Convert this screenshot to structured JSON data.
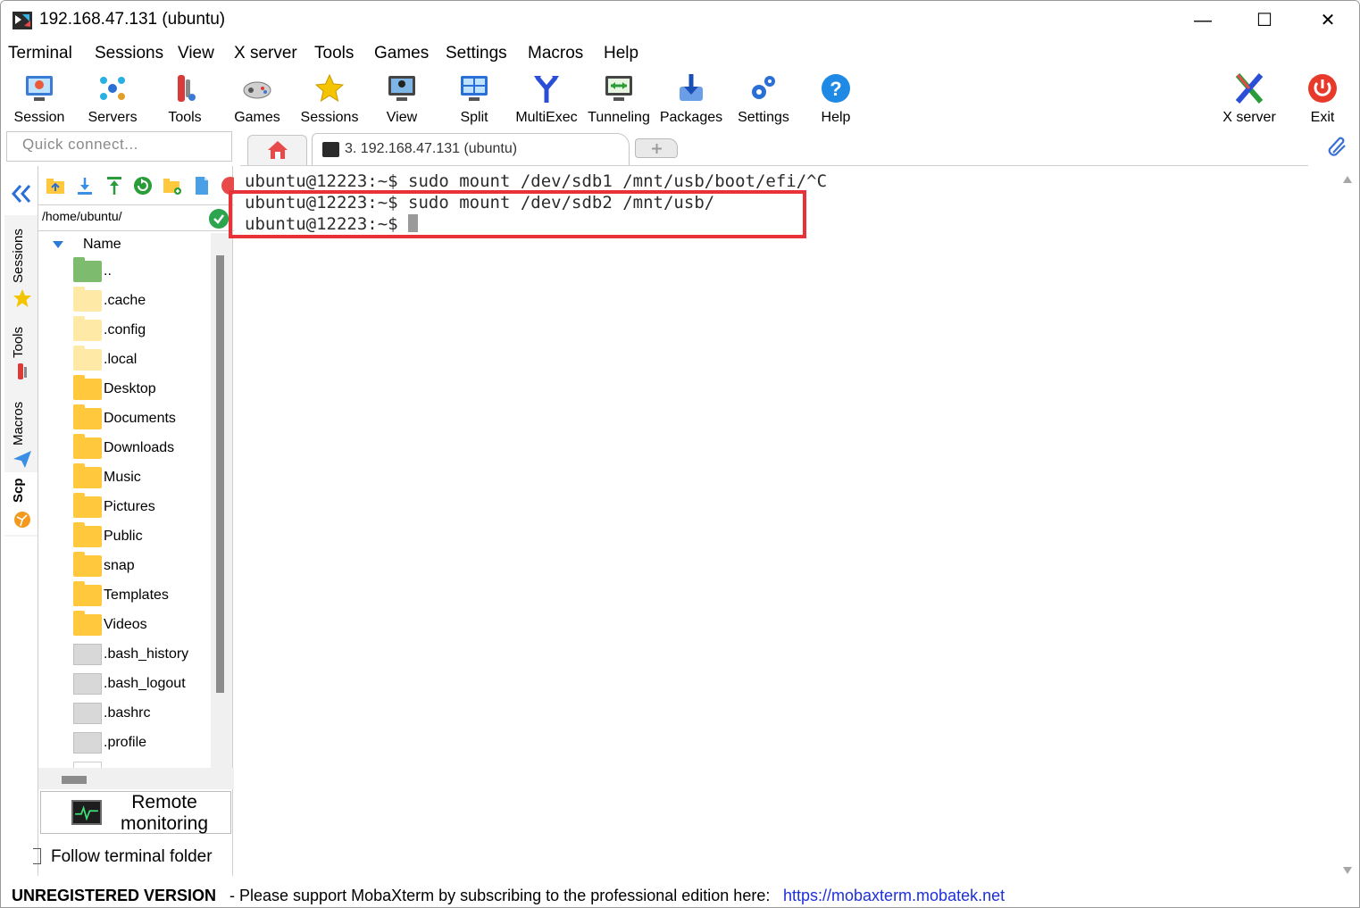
{
  "window": {
    "title": "192.168.47.131 (ubuntu)",
    "minimize_glyph": "—",
    "maximize_glyph": "☐",
    "close_glyph": "✕"
  },
  "menu": [
    "Terminal",
    "Sessions",
    "View",
    "X server",
    "Tools",
    "Games",
    "Settings",
    "Macros",
    "Help"
  ],
  "toolbar": {
    "session": "Session",
    "servers": "Servers",
    "tools": "Tools",
    "games": "Games",
    "sessions": "Sessions",
    "view": "View",
    "split": "Split",
    "multiexec": "MultiExec",
    "tunneling": "Tunneling",
    "packages": "Packages",
    "settings": "Settings",
    "help": "Help",
    "xserver": "X server",
    "exit": "Exit"
  },
  "quick_connect": {
    "placeholder": "Quick connect..."
  },
  "tabs": {
    "active_label": "3. 192.168.47.131 (ubuntu)"
  },
  "side_tabs": [
    "Sessions",
    "Tools",
    "Macros",
    "Scp"
  ],
  "file_browser": {
    "path": "/home/ubuntu/",
    "column_name": "Name",
    "entries": [
      {
        "name": "..",
        "kind": "up"
      },
      {
        "name": ".cache",
        "kind": "hidden-folder"
      },
      {
        "name": ".config",
        "kind": "hidden-folder"
      },
      {
        "name": ".local",
        "kind": "hidden-folder"
      },
      {
        "name": "Desktop",
        "kind": "folder"
      },
      {
        "name": "Documents",
        "kind": "folder"
      },
      {
        "name": "Downloads",
        "kind": "folder"
      },
      {
        "name": "Music",
        "kind": "folder"
      },
      {
        "name": "Pictures",
        "kind": "folder"
      },
      {
        "name": "Public",
        "kind": "folder"
      },
      {
        "name": "snap",
        "kind": "folder"
      },
      {
        "name": "Templates",
        "kind": "folder"
      },
      {
        "name": "Videos",
        "kind": "folder"
      },
      {
        "name": ".bash_history",
        "kind": "file"
      },
      {
        "name": ".bash_logout",
        "kind": "file"
      },
      {
        "name": ".bashrc",
        "kind": "file"
      },
      {
        "name": ".profile",
        "kind": "file"
      }
    ],
    "remote_monitoring": "Remote monitoring",
    "follow_terminal": "Follow terminal folder"
  },
  "terminal": {
    "lines": [
      "ubuntu@12223:~$ sudo mount /dev/sdb1 /mnt/usb/boot/efi/^C",
      "ubuntu@12223:~$ sudo mount /dev/sdb2 /mnt/usb/",
      "ubuntu@12223:~$ "
    ],
    "highlight_color": "#e8323a"
  },
  "status": {
    "unregistered": "UNREGISTERED VERSION",
    "message": "-   Please support MobaXterm by subscribing to the professional edition here:",
    "link": "https://mobaxterm.mobatek.net"
  }
}
